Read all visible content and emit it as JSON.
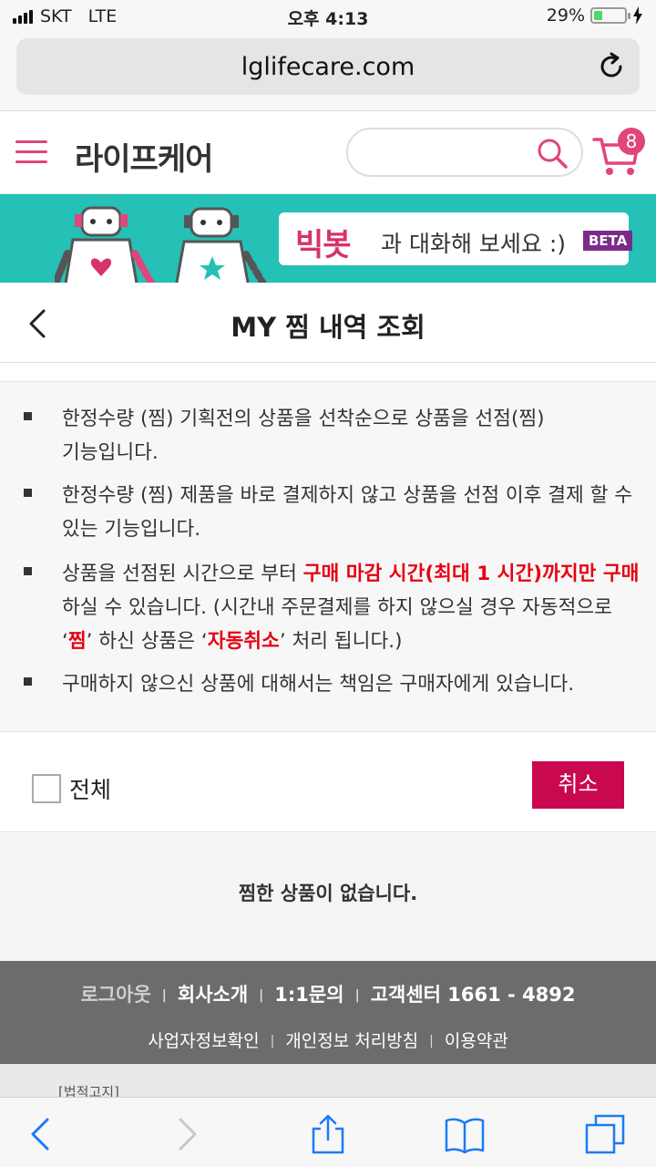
{
  "status": {
    "carrier": "SKT",
    "network": "LTE",
    "time": "오후 4:13",
    "battery": "29%",
    "battery_level": 0.29
  },
  "browser": {
    "url": "lglifecare.com",
    "reload_icon": "reload-icon"
  },
  "header": {
    "logo": "라이프케어",
    "cart_count": "8",
    "brand_color": "#e0457b"
  },
  "banner": {
    "bot_name": "빅봇",
    "text": "과 대화해 보세요 :)",
    "badge": "BETA"
  },
  "page": {
    "title": "MY 찜 내역 조회"
  },
  "notices": {
    "n1": "한정수량 (찜) 기획전의 상품을 선착순으로 상품을 선점(찜) 기능입니다.",
    "n2": "한정수량 (찜) 제품을 바로 결제하지 않고 상품을 선점 이후 결제 할 수 있는 기능입니다.",
    "n3a": "상품을 선점된 시간으로 부터 ",
    "n3b": "구매 마감 시간(최대 1 시간)까지만 구매",
    "n3c": " 하실 수 있습니다. (시간내 주문결제를 하지 않으실 경우 자동적으로 ‘",
    "n3d": "찜",
    "n3e": "’ 하신 상품은 ‘",
    "n3f": "자동취소",
    "n3g": "’ 처리 됩니다.)",
    "n4": "구매하지 않으신 상품에 대해서는 책임은 구매자에게 있습니다."
  },
  "select_all_label": "전체",
  "cancel_label": "취소",
  "empty_message": "찜한 상품이 없습니다.",
  "footer": {
    "logout": "로그아웃",
    "about": "회사소개",
    "inquiry": "1:1문의",
    "cs": "고객센터 1661 - 4892",
    "biz_info": "사업자정보확인",
    "privacy": "개인정보 처리방침",
    "terms": "이용약관",
    "legal": "[법적고지]"
  },
  "colors": {
    "accent": "#c9084f",
    "highlight": "#e60012",
    "banner_bg": "#25c0b6",
    "ios_blue": "#1a7cf5"
  }
}
